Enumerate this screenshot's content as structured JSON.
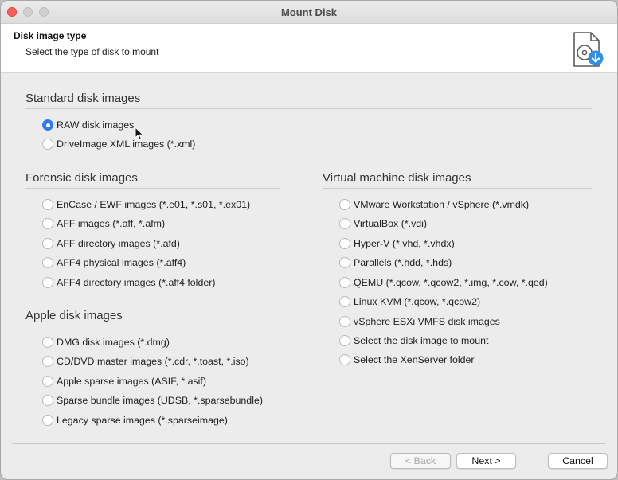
{
  "window": {
    "title": "Mount Disk"
  },
  "header": {
    "title": "Disk image type",
    "subtitle": "Select the type of disk to mount",
    "icon": "disk-image-download-icon"
  },
  "groups": {
    "standard": {
      "title": "Standard disk images",
      "options": [
        {
          "label": "RAW disk images",
          "checked": true
        },
        {
          "label": "DriveImage XML images (*.xml)",
          "checked": false
        }
      ]
    },
    "forensic": {
      "title": "Forensic disk images",
      "options": [
        {
          "label": "EnCase / EWF images (*.e01, *.s01, *.ex01)",
          "checked": false
        },
        {
          "label": "AFF images (*.aff, *.afm)",
          "checked": false
        },
        {
          "label": "AFF directory images (*.afd)",
          "checked": false
        },
        {
          "label": "AFF4 physical images (*.aff4)",
          "checked": false
        },
        {
          "label": "AFF4 directory images (*.aff4 folder)",
          "checked": false
        }
      ]
    },
    "apple": {
      "title": "Apple disk images",
      "options": [
        {
          "label": "DMG disk images (*.dmg)",
          "checked": false
        },
        {
          "label": "CD/DVD master images (*.cdr, *.toast, *.iso)",
          "checked": false
        },
        {
          "label": "Apple sparse images (ASIF, *.asif)",
          "checked": false
        },
        {
          "label": "Sparse bundle images (UDSB, *.sparsebundle)",
          "checked": false
        },
        {
          "label": "Legacy sparse images (*.sparseimage)",
          "checked": false
        }
      ]
    },
    "virtual": {
      "title": "Virtual machine disk images",
      "options": [
        {
          "label": "VMware Workstation / vSphere (*.vmdk)",
          "checked": false
        },
        {
          "label": "VirtualBox (*.vdi)",
          "checked": false
        },
        {
          "label": "Hyper-V (*.vhd, *.vhdx)",
          "checked": false
        },
        {
          "label": "Parallels (*.hdd, *.hds)",
          "checked": false
        },
        {
          "label": "QEMU (*.qcow, *.qcow2, *.img, *.cow, *.qed)",
          "checked": false
        },
        {
          "label": "Linux KVM (*.qcow, *.qcow2)",
          "checked": false
        },
        {
          "label": "vSphere ESXi VMFS disk images",
          "checked": false
        },
        {
          "label": "Select the disk image to mount",
          "checked": false
        },
        {
          "label": "Select the XenServer folder",
          "checked": false
        }
      ]
    }
  },
  "buttons": {
    "back": {
      "label": "< Back",
      "enabled": false
    },
    "next": {
      "label": "Next >",
      "enabled": true
    },
    "cancel": {
      "label": "Cancel",
      "enabled": true
    }
  },
  "colors": {
    "accent": "#2f7df6",
    "close_button": "#fe5f57"
  }
}
